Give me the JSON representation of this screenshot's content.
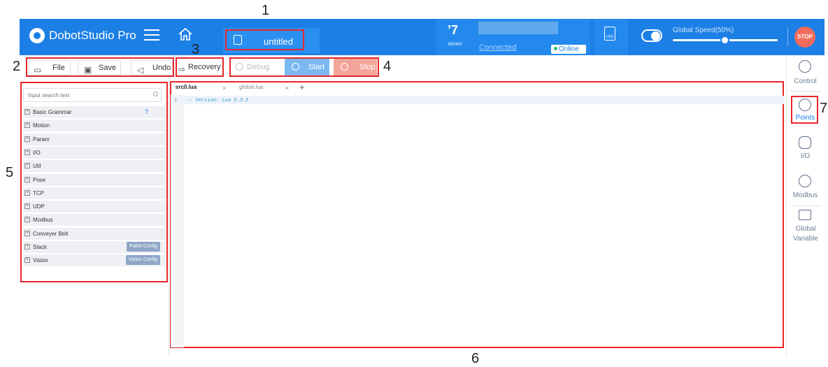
{
  "app": {
    "name": "DobotStudio Pro",
    "project_title": "untitled"
  },
  "robot": {
    "model": "MG400",
    "status": "Connected",
    "online": "Online"
  },
  "speed": {
    "label": "Global Speed(50%)",
    "value_percent": 50
  },
  "header": {
    "stop_label": "STOP",
    "log_label": "LOG"
  },
  "toolbar": {
    "file": "File",
    "save": "Save",
    "undo": "Undo",
    "recovery": "Recovery",
    "debug": "Debug",
    "start": "Start",
    "stop": "Stop"
  },
  "annotations": [
    "1",
    "2",
    "3",
    "4",
    "5",
    "6",
    "7"
  ],
  "left_panel": {
    "search_placeholder": "Input search text",
    "categories": [
      {
        "label": "Basic Grammar",
        "help": "?"
      },
      {
        "label": "Motion"
      },
      {
        "label": "Param"
      },
      {
        "label": "I/O"
      },
      {
        "label": "Util"
      },
      {
        "label": "Pose"
      },
      {
        "label": "TCP"
      },
      {
        "label": "UDP"
      },
      {
        "label": "Modbus"
      },
      {
        "label": "Conveyer Belt"
      },
      {
        "label": "Stack",
        "tag": "Pallet Config"
      },
      {
        "label": "Vision",
        "tag": "Vision Config"
      }
    ]
  },
  "editor": {
    "tabs": [
      "src0.lua",
      "global.lua"
    ],
    "close_symbol": "×",
    "add_symbol": "+",
    "lines": [
      {
        "no": "1",
        "text": "-- Version: Lua 5.3.5"
      }
    ]
  },
  "right_panel": {
    "items": [
      "Control",
      "Points",
      "I/O",
      "Modbus",
      "Global Variable"
    ]
  },
  "colors": {
    "primary": "#1c7fe6",
    "stop": "#f26b5b",
    "annotation": "#e8262b"
  }
}
